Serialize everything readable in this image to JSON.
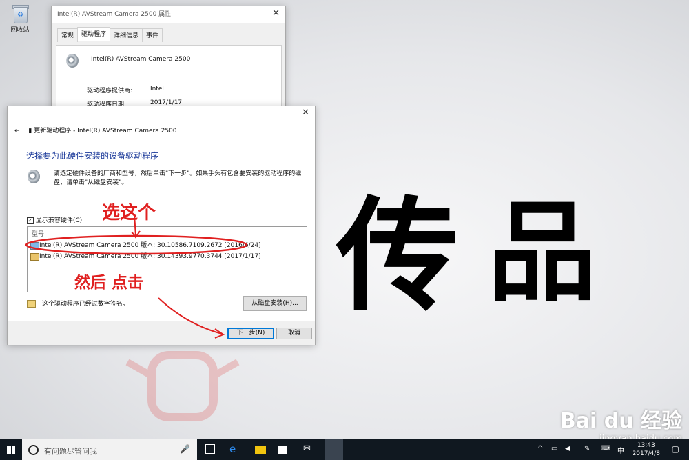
{
  "desktop": {
    "recycle_bin_label": "回收站",
    "big_text_1": "传",
    "big_text_2": "品"
  },
  "props_dialog": {
    "title": "Intel(R) AVStream Camera 2500 属性",
    "tabs": [
      "常规",
      "驱动程序",
      "详细信息",
      "事件"
    ],
    "device_name": "Intel(R) AVStream Camera 2500",
    "provider_label": "驱动程序提供商:",
    "provider_value": "Intel",
    "date_label": "驱动程序日期:",
    "date_value": "2017/1/17"
  },
  "update_dialog": {
    "header": "更新驱动程序 - Intel(R) AVStream Camera 2500",
    "heading": "选择要为此硬件安装的设备驱动程序",
    "instruction": "请选定硬件设备的厂商和型号，然后单击\"下一步\"。如果手头有包含要安装的驱动程序的磁盘，请单击\"从磁盘安装\"。",
    "compat_checkbox": "显示兼容硬件(C)",
    "list_header": "型号",
    "drivers": [
      "Intel(R) AVStream Camera 2500 版本: 30.10586.7109.2672 [2016/6/24]",
      "Intel(R) AVStream Camera 2500 版本: 30.14393.9770.3744 [2017/1/17]"
    ],
    "signed_note": "这个驱动程序已经过数字签名。",
    "have_disk_button": "从磁盘安装(H)...",
    "next_button": "下一步(N)",
    "cancel_button": "取消"
  },
  "annotations": {
    "select_this": "选这个",
    "then_click": "然后 点击"
  },
  "taskbar": {
    "search_placeholder": "有问题尽管问我",
    "ime": "中",
    "time": "13:43",
    "date": "2017/4/8"
  },
  "watermark": {
    "brand": "Bai du 经验",
    "url": "jingyan.baidu.com"
  }
}
